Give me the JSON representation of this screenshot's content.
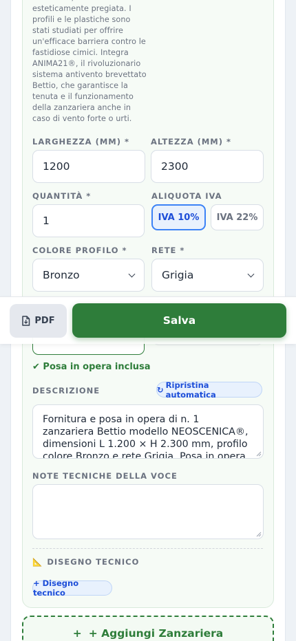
{
  "description_text": "resistente, funzionale ed esteticamente pregiata. I profili e le plastiche sono stati studiati per offrire un'efficace barriera contro le fastidiose cimici. Integra ANIMA21®, il rivoluzionario sistema antivento brevettato Bettio, che garantisce la tenuta e il funzionamento della zanzariera anche in caso di vento forte o urti.",
  "fields": {
    "larghezza": {
      "label": "LARGHEZZA (MM) *",
      "value": "1200"
    },
    "altezza": {
      "label": "ALTEZZA (MM) *",
      "value": "2300"
    },
    "quantita": {
      "label": "QUANTITÀ *",
      "value": "1"
    },
    "aliquota": {
      "label": "ALIQUOTA IVA",
      "options": [
        "IVA 10%",
        "IVA 22%"
      ],
      "selected": "IVA 10%"
    },
    "colore": {
      "label": "COLORE PROFILO *",
      "value": "Bronzo"
    },
    "rete": {
      "label": "RETE *",
      "value": "Grigia"
    }
  },
  "sticky_bar": {
    "pdf_label": "PDF",
    "save_label": "Salva"
  },
  "posa_label": "✔ Posa in opera inclusa",
  "descrizione": {
    "label": "DESCRIZIONE",
    "reset_label": "Ripristina automatica",
    "value": "Fornitura e posa in opera di n. 1 zanzariera Bettio modello NEOSCENICA®, dimensioni L 1.200 × H 2.300 mm, profilo colore Bronzo e rete Grigia. Posa in opera inclusa."
  },
  "note": {
    "label": "NOTE TECNICHE DELLA VOCE",
    "value": ""
  },
  "disegno": {
    "label": "DISEGNO TECNICO",
    "icon": "📐",
    "add_label": "+ Disegno tecnico"
  },
  "add_button": {
    "icon": "+",
    "label": "+ Aggiungi Zanzariera"
  },
  "colors": {
    "primary_green": "#2e7d3a",
    "accent_blue": "#3b82f6"
  }
}
